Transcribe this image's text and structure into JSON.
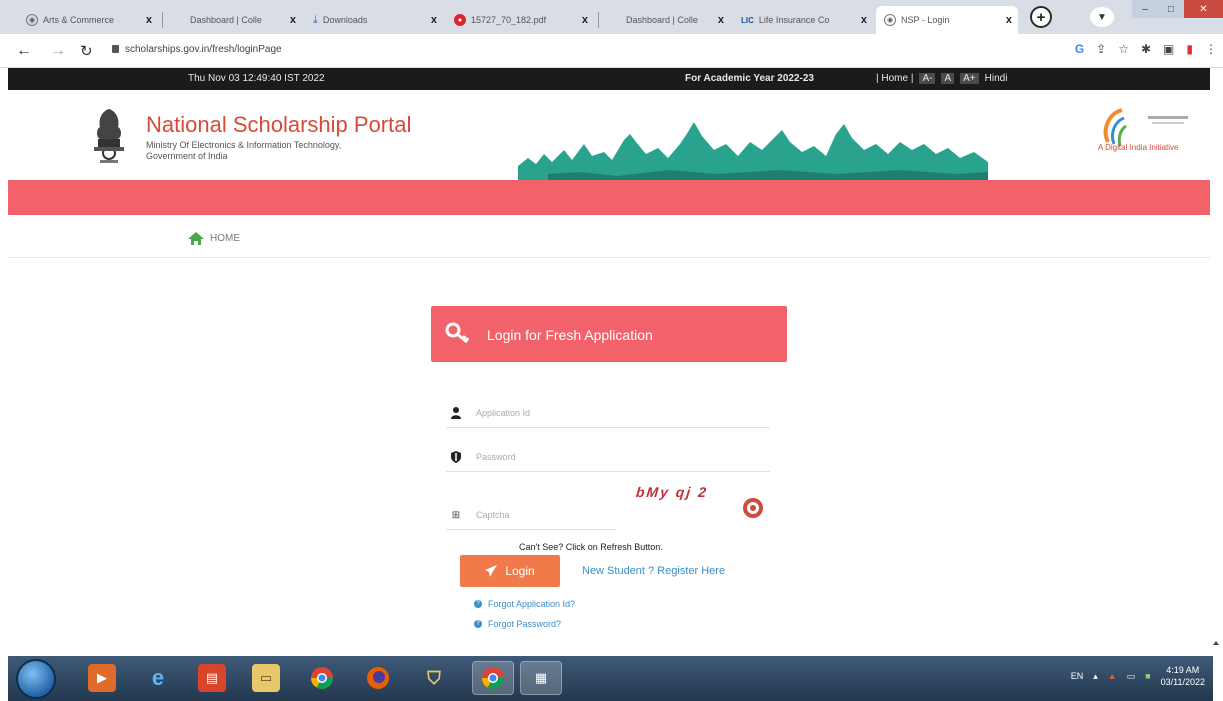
{
  "browser": {
    "tabs": [
      {
        "label": "Arts & Commerce",
        "close": "x"
      },
      {
        "label": "Dashboard | Colle",
        "close": "x"
      },
      {
        "label": "Downloads",
        "close": "x"
      },
      {
        "label": "15727_70_182.pdf",
        "close": "x"
      },
      {
        "label": "Dashboard | Colle",
        "close": "x"
      },
      {
        "label": "Life Insurance Co",
        "close": "x"
      },
      {
        "label": "NSP - Login",
        "close": "x"
      }
    ],
    "new_tab": "+",
    "url": "scholarships.gov.in/fresh/loginPage"
  },
  "topbar": {
    "datetime": "Thu Nov 03 12:49:40 IST 2022",
    "academic_year": "For Academic Year 2022-23",
    "home_sep": "| Home |",
    "font_small": "A-",
    "font_normal": "A",
    "font_large": "A+",
    "hindi": "Hindi"
  },
  "header": {
    "title": "National Scholarship Portal",
    "subtitle1": "Ministry Of Electronics & Information Technology,",
    "subtitle2": "Government of India",
    "digital_india_tag": "A Digital India Initiative"
  },
  "nav": {
    "home": "HOME"
  },
  "login": {
    "heading": "Login for Fresh Application",
    "application_id_placeholder": "Application Id",
    "password_placeholder": "Password",
    "captcha_placeholder": "Captcha",
    "captcha_text": "bMy qj 2",
    "cant_see": "Can't See? Click on Refresh Button.",
    "login_button": "Login",
    "register_link": "New Student ? Register Here",
    "forgot_app_id": "Forgot Application Id?",
    "forgot_password": "Forgot Password?"
  },
  "taskbar": {
    "lang": "EN",
    "time": "4:19 AM",
    "date": "03/11/2022"
  },
  "colors": {
    "brand_red": "#f2626a",
    "button_orange": "#f07a4a",
    "link_blue": "#3a8ecb"
  }
}
